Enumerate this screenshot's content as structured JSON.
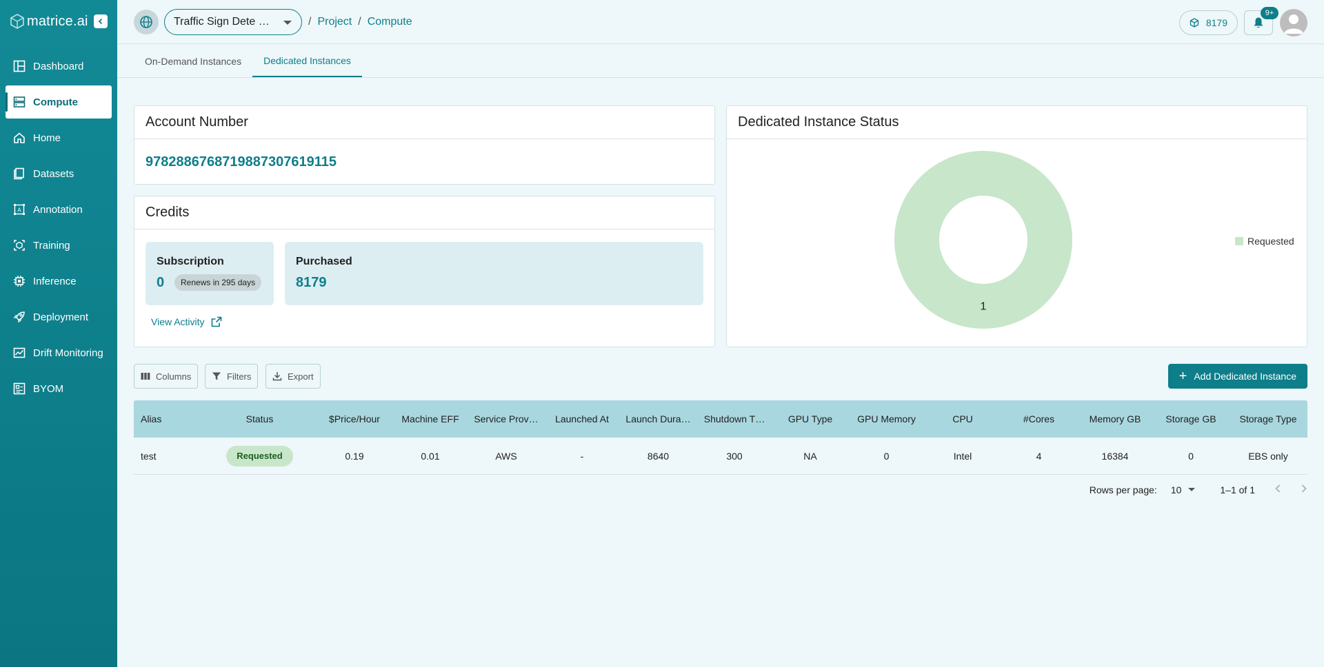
{
  "app": {
    "brand": "matrice.ai"
  },
  "sidebar": {
    "items": [
      {
        "label": "Dashboard",
        "icon": "dashboard-icon",
        "active": false
      },
      {
        "label": "Compute",
        "icon": "compute-icon",
        "active": true
      },
      {
        "label": "Home",
        "icon": "home-icon",
        "active": false
      },
      {
        "label": "Datasets",
        "icon": "datasets-icon",
        "active": false
      },
      {
        "label": "Annotation",
        "icon": "annotation-icon",
        "active": false
      },
      {
        "label": "Training",
        "icon": "training-icon",
        "active": false
      },
      {
        "label": "Inference",
        "icon": "inference-icon",
        "active": false
      },
      {
        "label": "Deployment",
        "icon": "deployment-icon",
        "active": false
      },
      {
        "label": "Drift Monitoring",
        "icon": "drift-monitoring-icon",
        "active": false
      },
      {
        "label": "BYOM",
        "icon": "byom-icon",
        "active": false
      }
    ]
  },
  "header": {
    "project_select": "Traffic Sign Dete …",
    "breadcrumbs": [
      "Project",
      "Compute"
    ],
    "credits": "8179",
    "notifications_badge": "9+"
  },
  "tabs": [
    {
      "label": "On-Demand Instances",
      "active": false
    },
    {
      "label": "Dedicated Instances",
      "active": true
    }
  ],
  "account": {
    "title": "Account Number",
    "number": "97828867687198873076191​15"
  },
  "credits": {
    "title": "Credits",
    "subscription_label": "Subscription",
    "subscription_value": "0",
    "renews_chip": "Renews in 295 days",
    "purchased_label": "Purchased",
    "purchased_value": "8179",
    "view_activity": "View Activity"
  },
  "status_chart": {
    "title": "Dedicated Instance Status",
    "legend": "Requested",
    "slice_label": "1"
  },
  "chart_data": {
    "type": "pie",
    "title": "Dedicated Instance Status",
    "categories": [
      "Requested"
    ],
    "values": [
      1
    ],
    "colors": [
      "#c8e6c9"
    ],
    "legend": "right"
  },
  "toolbar": {
    "columns": "Columns",
    "filters": "Filters",
    "export": "Export",
    "add": "Add Dedicated Instance"
  },
  "table": {
    "headers": [
      "Alias",
      "Status",
      "$Price/Hour",
      "Machine EFF",
      "Service Prov…",
      "Launched At",
      "Launch Dura…",
      "Shutdown T…",
      "GPU Type",
      "GPU Memory",
      "CPU",
      "#Cores",
      "Memory GB",
      "Storage GB",
      "Storage Type"
    ],
    "rows": [
      [
        "test",
        "Requested",
        "0.19",
        "0.01",
        "AWS",
        "-",
        "8640",
        "300",
        "NA",
        "0",
        "Intel",
        "4",
        "16384",
        "0",
        "EBS only"
      ]
    ]
  },
  "pagination": {
    "rows_per_page_label": "Rows per page:",
    "rows_per_page": "10",
    "range": "1–1 of 1"
  },
  "colors": {
    "sidebar": "#0d7e8a",
    "accent": "#0d7e8a",
    "table_header": "#a9d7df",
    "status_requested": "#c8e6c9"
  }
}
